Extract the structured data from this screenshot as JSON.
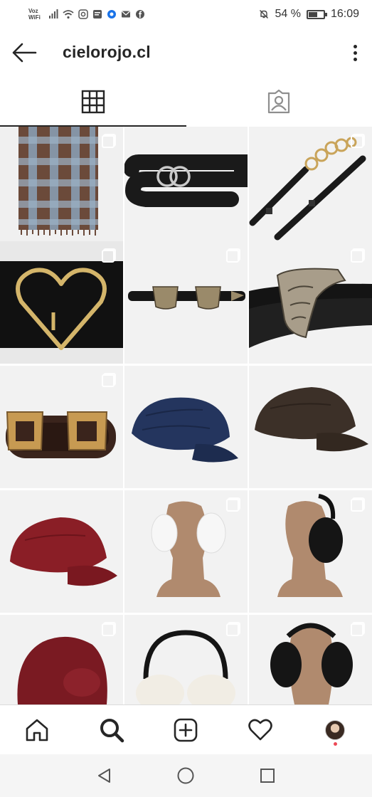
{
  "status_bar": {
    "carrier_line1": "Voz",
    "carrier_line2": "WiFi",
    "battery_text": "54 %",
    "battery_level": 0.54,
    "time": "16:09"
  },
  "header": {
    "title": "cielorojo.cl",
    "back_icon": "arrow-left-icon",
    "menu_icon": "more-vertical-icon"
  },
  "tabs": [
    {
      "icon": "grid-icon",
      "active": true
    },
    {
      "icon": "tagged-icon",
      "active": false
    }
  ],
  "grid": {
    "items": [
      {
        "subject": "plaid-scarf",
        "multi": true
      },
      {
        "subject": "double-ring-belt",
        "multi": false
      },
      {
        "subject": "chain-belt",
        "multi": true
      },
      {
        "subject": "heart-buckle-belt",
        "multi": true
      },
      {
        "subject": "western-double-buckle-belt",
        "multi": true
      },
      {
        "subject": "engraved-buckle-belt",
        "multi": true
      },
      {
        "subject": "gold-double-buckle-belt",
        "multi": true
      },
      {
        "subject": "navy-newsboy-cap",
        "multi": false
      },
      {
        "subject": "brown-newsboy-cap",
        "multi": false
      },
      {
        "subject": "red-newsboy-cap",
        "multi": false
      },
      {
        "subject": "white-earmuffs",
        "multi": true
      },
      {
        "subject": "black-earmuffs",
        "multi": true
      },
      {
        "subject": "red-fur-hat",
        "multi": true
      },
      {
        "subject": "cream-earmuffs",
        "multi": true
      },
      {
        "subject": "black-fur-earmuffs",
        "multi": true
      }
    ]
  },
  "bottom_nav": [
    {
      "icon": "home-icon"
    },
    {
      "icon": "search-icon",
      "active": true
    },
    {
      "icon": "add-post-icon"
    },
    {
      "icon": "heart-icon"
    },
    {
      "icon": "profile-avatar"
    }
  ],
  "system_nav": [
    {
      "icon": "back-triangle-icon"
    },
    {
      "icon": "home-circle-icon"
    },
    {
      "icon": "recents-square-icon"
    }
  ]
}
